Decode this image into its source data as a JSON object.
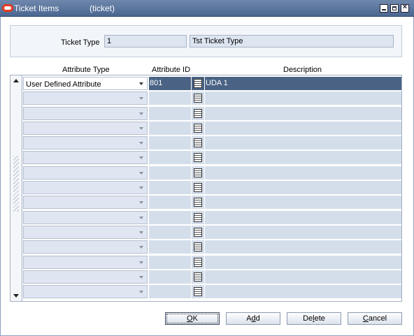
{
  "window": {
    "title": "Ticket Items",
    "subtitle": "(ticket)"
  },
  "ticket_type": {
    "label": "Ticket Type",
    "id_value": "1",
    "description_value": "Tst Ticket Type"
  },
  "grid": {
    "columns": [
      "Attribute Type",
      "Attribute ID",
      "Description"
    ],
    "rows": [
      {
        "attribute_type": "User Defined Attribute",
        "attribute_id": "801",
        "description": "UDA 1",
        "selected": true
      },
      {
        "attribute_type": "",
        "attribute_id": "",
        "description": ""
      },
      {
        "attribute_type": "",
        "attribute_id": "",
        "description": ""
      },
      {
        "attribute_type": "",
        "attribute_id": "",
        "description": ""
      },
      {
        "attribute_type": "",
        "attribute_id": "",
        "description": ""
      },
      {
        "attribute_type": "",
        "attribute_id": "",
        "description": ""
      },
      {
        "attribute_type": "",
        "attribute_id": "",
        "description": ""
      },
      {
        "attribute_type": "",
        "attribute_id": "",
        "description": ""
      },
      {
        "attribute_type": "",
        "attribute_id": "",
        "description": ""
      },
      {
        "attribute_type": "",
        "attribute_id": "",
        "description": ""
      },
      {
        "attribute_type": "",
        "attribute_id": "",
        "description": ""
      },
      {
        "attribute_type": "",
        "attribute_id": "",
        "description": ""
      },
      {
        "attribute_type": "",
        "attribute_id": "",
        "description": ""
      },
      {
        "attribute_type": "",
        "attribute_id": "",
        "description": ""
      },
      {
        "attribute_type": "",
        "attribute_id": "",
        "description": ""
      }
    ]
  },
  "buttons": {
    "ok": {
      "before": "",
      "mnemonic": "O",
      "after": "K"
    },
    "add": {
      "before": "A",
      "mnemonic": "d",
      "after": "d"
    },
    "delete": {
      "before": "De",
      "mnemonic": "l",
      "after": "ete"
    },
    "cancel": {
      "before": "",
      "mnemonic": "C",
      "after": "ancel"
    }
  },
  "icons": {
    "app": "oracle-logo-icon",
    "minimize": "minimize-icon",
    "maximize": "maximize-icon",
    "close": "close-icon",
    "lov": "list-of-values-icon",
    "dropdown": "chevron-down-icon"
  },
  "colors": {
    "titlebar": "#4b6790",
    "selected_row": "#4a6384",
    "cell_background": "#d4deeb",
    "logo": "#e53a1e"
  }
}
